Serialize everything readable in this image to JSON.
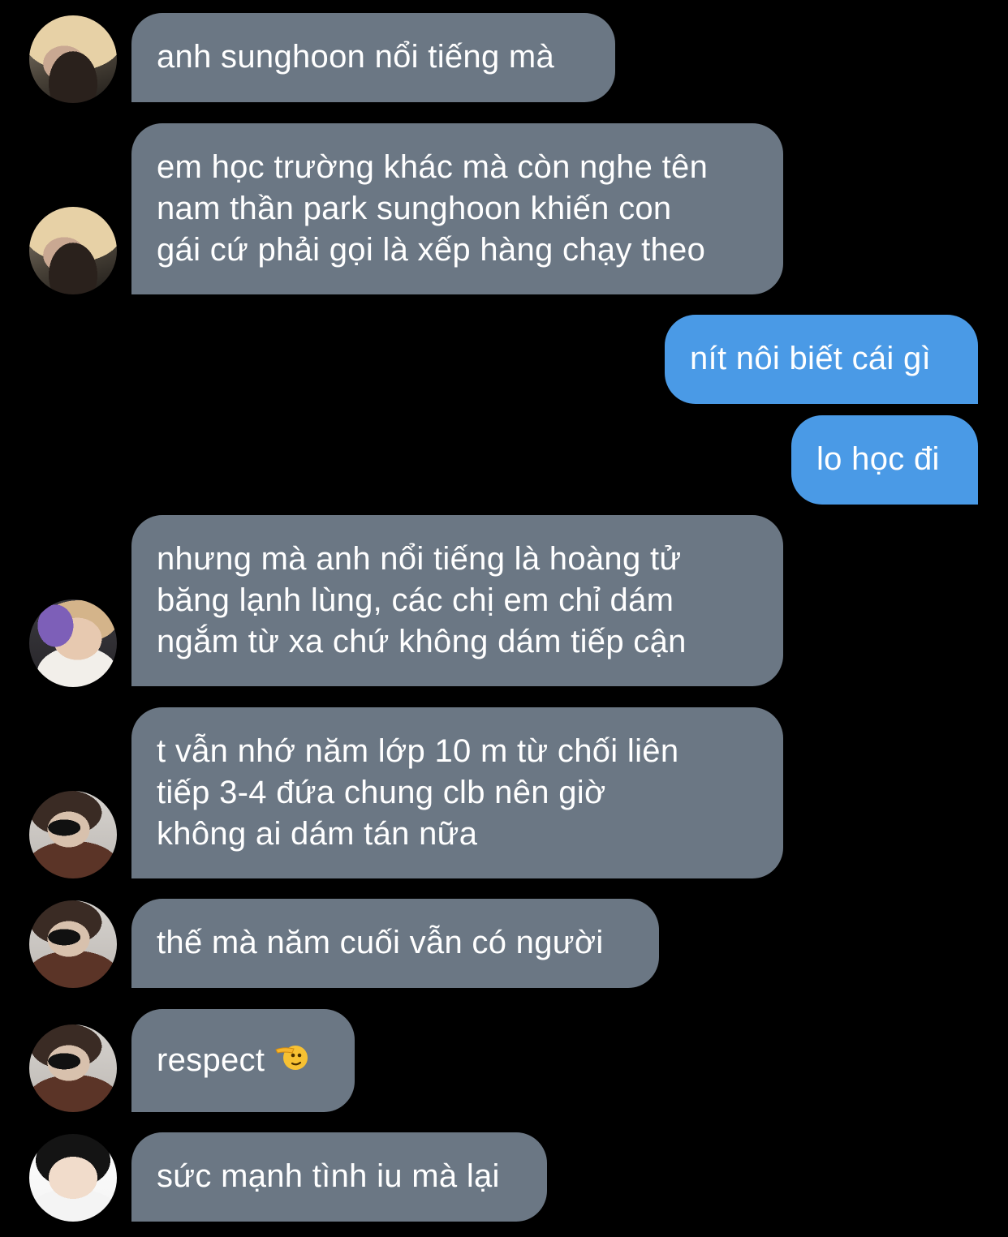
{
  "chat": {
    "messages": [
      {
        "direction": "incoming",
        "text": "anh sunghoon nổi tiếng mà",
        "avatar": "blonde-hair-avatar"
      },
      {
        "direction": "incoming",
        "text": "em học trường khác mà còn nghe tên\nnam thần park sunghoon khiến con\ngái cứ phải gọi là xếp hàng chạy theo",
        "avatar": "blonde-hair-avatar"
      },
      {
        "direction": "outgoing",
        "text": "nít nôi biết cái gì"
      },
      {
        "direction": "outgoing",
        "text": "lo học đi"
      },
      {
        "direction": "incoming",
        "text": "nhưng mà anh nổi tiếng là hoàng tử\nbăng lạnh lùng, các chị em chỉ dám\nngắm từ xa chứ không dám tiếp cận",
        "avatar": "phone-selfie-avatar"
      },
      {
        "direction": "incoming",
        "text": "t vẫn nhớ năm lớp 10 m từ chối liên\ntiếp 3-4 đứa chung clb nên giờ\nkhông ai dám tán nữa",
        "avatar": "glasses-avatar"
      },
      {
        "direction": "incoming",
        "text": "thế mà năm cuối vẫn có người",
        "avatar": "glasses-avatar"
      },
      {
        "direction": "incoming",
        "text": "respect",
        "emoji": "saluting-face-icon",
        "avatar": "glasses-avatar"
      },
      {
        "direction": "incoming",
        "text": "sức mạnh tình iu mà lại",
        "avatar": "heart-hand-avatar"
      }
    ]
  },
  "colors": {
    "background": "#000000",
    "incoming_bubble": "#6b7784",
    "outgoing_bubble": "#4a9ae6",
    "text": "#ffffff"
  }
}
